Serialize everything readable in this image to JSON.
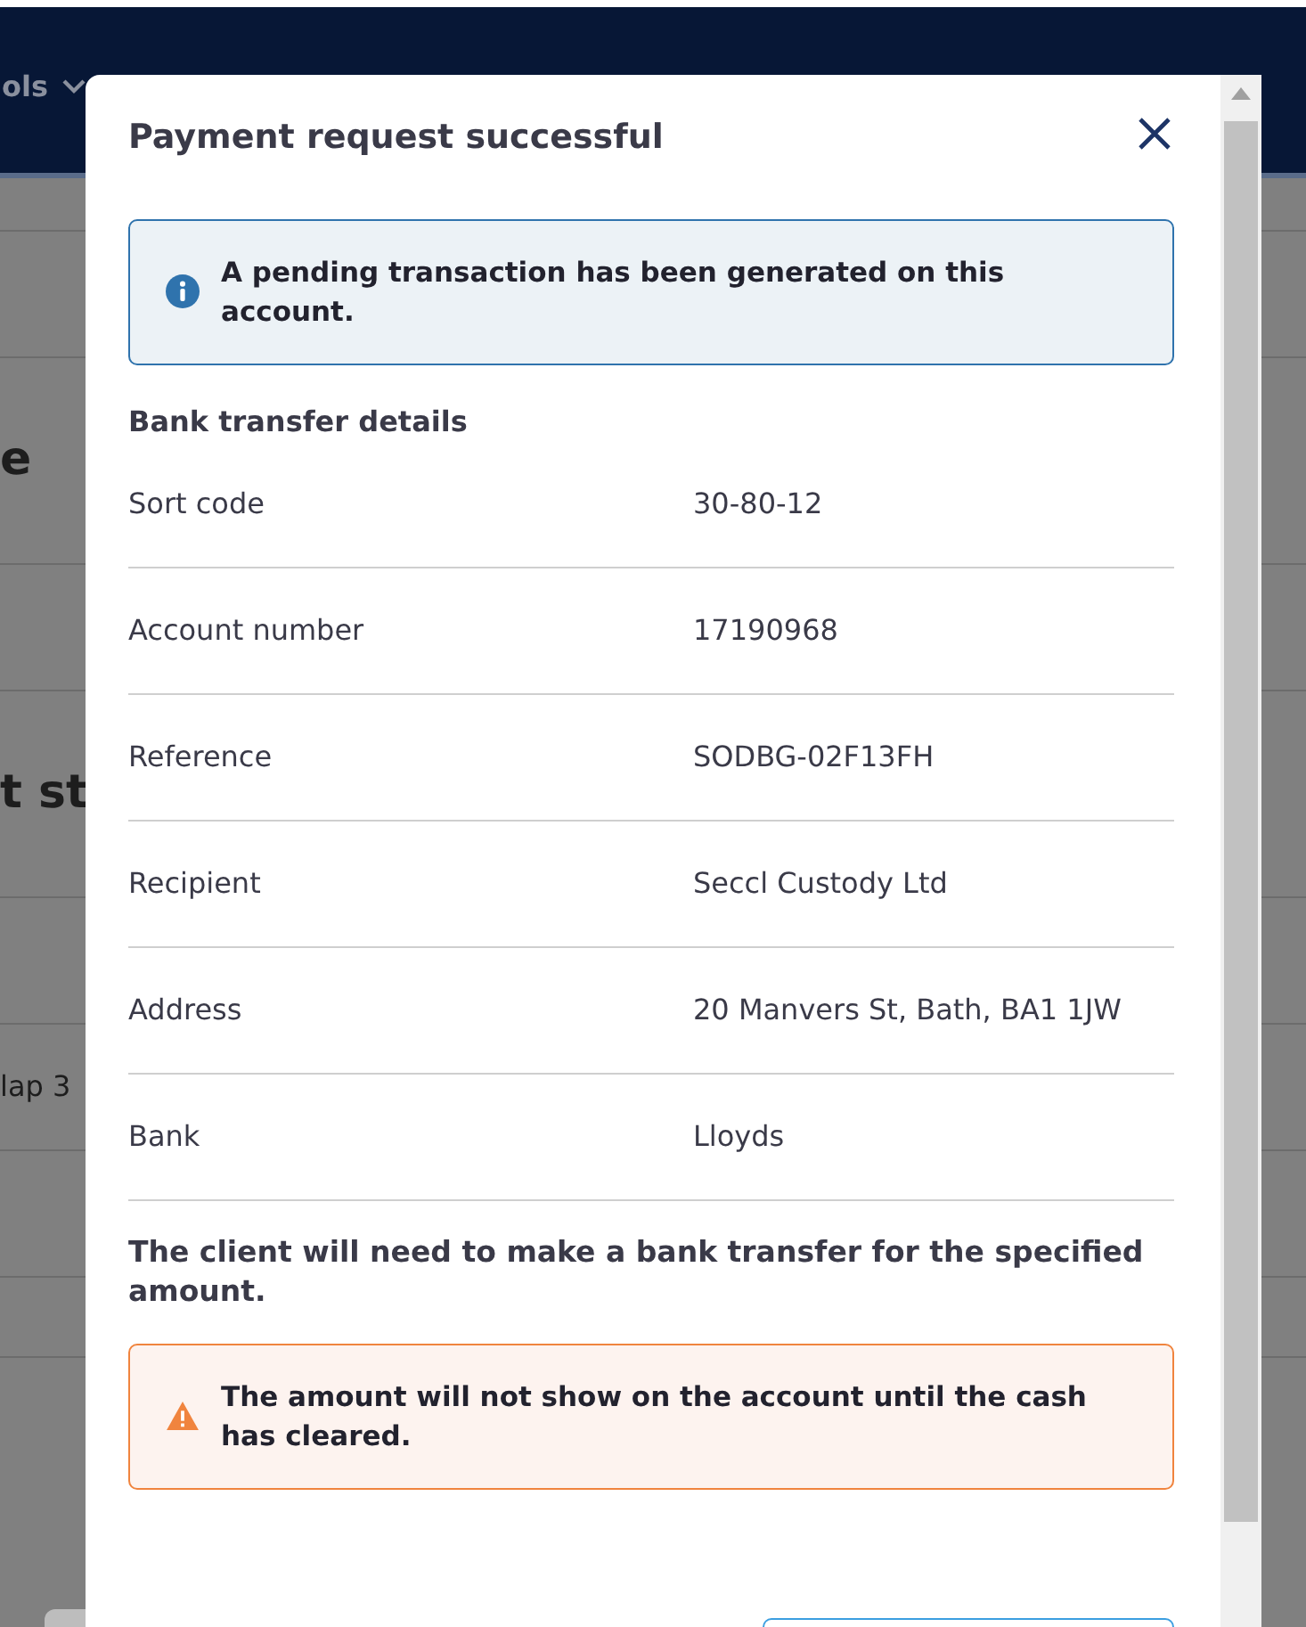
{
  "background": {
    "nav_item": "ols",
    "fragments": [
      "e",
      "t st",
      "lap 3"
    ]
  },
  "modal": {
    "title": "Payment request successful",
    "info_alert": "A pending transaction has been generated on this account.",
    "section_title": "Bank transfer details",
    "details": [
      {
        "label": "Sort code",
        "value": "30-80-12"
      },
      {
        "label": "Account number",
        "value": "17190968"
      },
      {
        "label": "Reference",
        "value": "SODBG-02F13FH"
      },
      {
        "label": "Recipient",
        "value": "Seccl Custody Ltd"
      },
      {
        "label": "Address",
        "value": "20 Manvers St, Bath, BA1 1JW"
      },
      {
        "label": "Bank",
        "value": "Lloyds"
      }
    ],
    "note": "The client will need to make a bank transfer for the specified amount.",
    "warning_alert": "The amount will not show on the account until the cash has cleared."
  }
}
